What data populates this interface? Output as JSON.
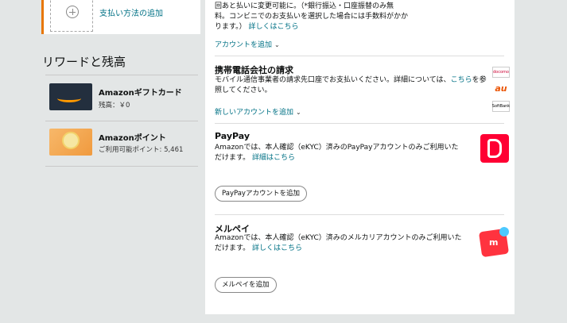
{
  "left": {
    "add_payment_label": "支払い方法の追加",
    "rewards_title": "リワードと残高",
    "rewards": [
      {
        "title": "Amazonギフトカード",
        "sub": "残高：￥0"
      },
      {
        "title": "Amazonポイント",
        "sub": "ご利用可能ポイント: 5,461"
      }
    ]
  },
  "right": {
    "top_text": [
      "回あと払いに変更可能に。（*銀行振込・口座振替のみ無",
      "料。コンビニでのお支払いを選択した場合には手数料がかか",
      "ります。）"
    ],
    "top_details_link": "詳しくはこちら",
    "account_add_link": "アカウントを追加",
    "carrier": {
      "heading": "携帯電話会社の請求",
      "line1_pre": "モバイル通信事業者の請求先口座でお支払いください。詳細については、",
      "line1_link": "こちら",
      "line1_post": "を参",
      "line2": "照してください。",
      "new_account_link": "新しいアカウントを追加",
      "logos": {
        "docomo": "docomo",
        "au": "au",
        "softbank": "SoftBank"
      }
    },
    "paypay": {
      "heading": "PayPay",
      "line1": "Amazonでは、本人確認（eKYC）済みのPayPayアカウントのみご利用いた",
      "line2": "だけます。",
      "details_link": "詳細はこちら",
      "button": "PayPayアカウントを追加"
    },
    "merpay": {
      "heading": "メルペイ",
      "line1": "Amazonでは、本人確認（eKYC）済みのメルカリアカウントのみご利用いた",
      "line2": "だけます。",
      "details_link": "詳しくはこちら",
      "button": "メルペイを追加",
      "logo_letter": "m"
    }
  },
  "colors": {
    "link": "#007185",
    "accent": "#e77600",
    "paypay": "#ff0033",
    "merpay": "#ff333f"
  }
}
